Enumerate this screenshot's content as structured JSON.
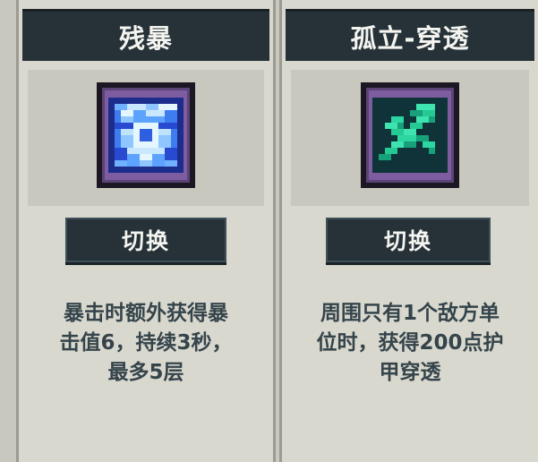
{
  "cards": [
    {
      "title": "残暴",
      "icon": "shattered-crystal-icon",
      "button_label": "切换",
      "description": "暴击时额外获得暴\n击值6，持续3秒，\n最多5层"
    },
    {
      "title": "孤立-穿透",
      "icon": "piercing-arrow-icon",
      "button_label": "切换",
      "description": "周围只有1个敌方单\n位时，获得200点护\n甲穿透"
    }
  ],
  "colors": {
    "background": "#c9c8bf",
    "header": "#263238",
    "text_dark": "#35444b",
    "icon_frame": "#7d5ca0"
  }
}
